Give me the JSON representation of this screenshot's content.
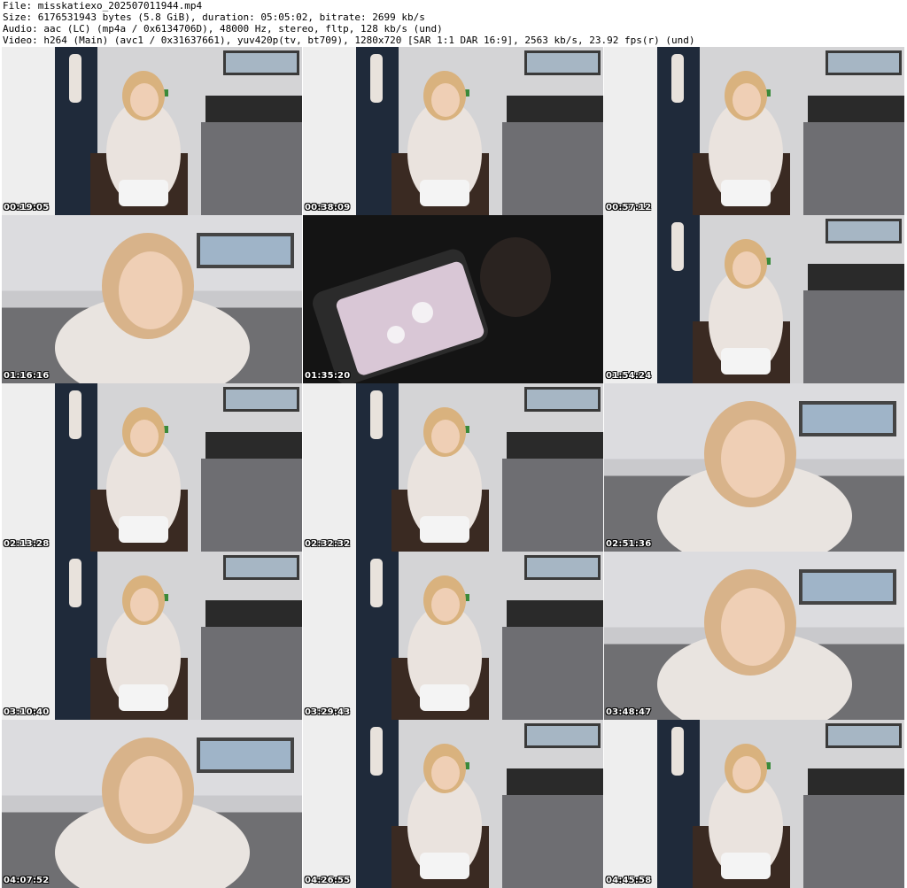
{
  "header": {
    "line1": "File: misskatiexo_202507011944.mp4",
    "line2": "Size: 6176531943 bytes (5.8 GiB), duration: 05:05:02, bitrate: 2699 kb/s",
    "line3": "Audio: aac (LC) (mp4a / 0x6134706D), 48000 Hz, stereo, fltp, 128 kb/s (und)",
    "line4": "Video: h264 (Main) (avc1 / 0x31637661), yuv420p(tv, bt709), 1280x720 [SAR 1:1 DAR 16:9], 2563 kb/s, 23.92 fps(r) (und)"
  },
  "thumbnails": [
    {
      "timestamp": "00:19:05",
      "scene": "wide"
    },
    {
      "timestamp": "00:38:09",
      "scene": "wide"
    },
    {
      "timestamp": "00:57:12",
      "scene": "wide"
    },
    {
      "timestamp": "01:16:16",
      "scene": "close"
    },
    {
      "timestamp": "01:35:20",
      "scene": "dark"
    },
    {
      "timestamp": "01:54:24",
      "scene": "wide"
    },
    {
      "timestamp": "02:13:28",
      "scene": "wide"
    },
    {
      "timestamp": "02:32:32",
      "scene": "wide"
    },
    {
      "timestamp": "02:51:36",
      "scene": "close"
    },
    {
      "timestamp": "03:10:40",
      "scene": "wide"
    },
    {
      "timestamp": "03:29:43",
      "scene": "wide"
    },
    {
      "timestamp": "03:48:47",
      "scene": "close"
    },
    {
      "timestamp": "04:07:52",
      "scene": "close"
    },
    {
      "timestamp": "04:26:55",
      "scene": "wide"
    },
    {
      "timestamp": "04:45:58",
      "scene": "wide"
    }
  ]
}
